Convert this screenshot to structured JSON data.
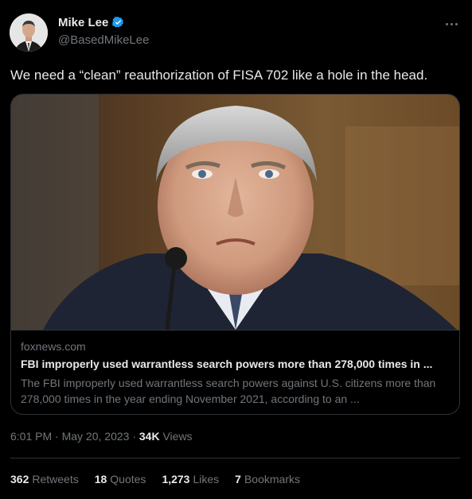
{
  "author": {
    "name": "Mike Lee",
    "handle": "@BasedMikeLee",
    "verified": true
  },
  "icons": {
    "verified": "verified-badge-icon",
    "more": "more-options-icon"
  },
  "colors": {
    "background": "#000000",
    "text_primary": "#e7e9ea",
    "text_secondary": "#71767b",
    "border": "#2f3336",
    "verified_blue": "#1d9bf0"
  },
  "tweet": {
    "text": "We need a “clean” reauthorization of FISA 702 like a hole in the head."
  },
  "card": {
    "domain": "foxnews.com",
    "title": "FBI improperly used warrantless search powers more than 278,000 times in ...",
    "description": "The FBI improperly used warrantless search powers against U.S. citizens more than 278,000 times in the year ending November 2021, according to an ..."
  },
  "meta": {
    "time": "6:01 PM",
    "separator": "·",
    "date": "May 20, 2023",
    "views_count": "34K",
    "views_label": "Views"
  },
  "stats": [
    {
      "count": "362",
      "label": "Retweets"
    },
    {
      "count": "18",
      "label": "Quotes"
    },
    {
      "count": "1,273",
      "label": "Likes"
    },
    {
      "count": "7",
      "label": "Bookmarks"
    }
  ]
}
